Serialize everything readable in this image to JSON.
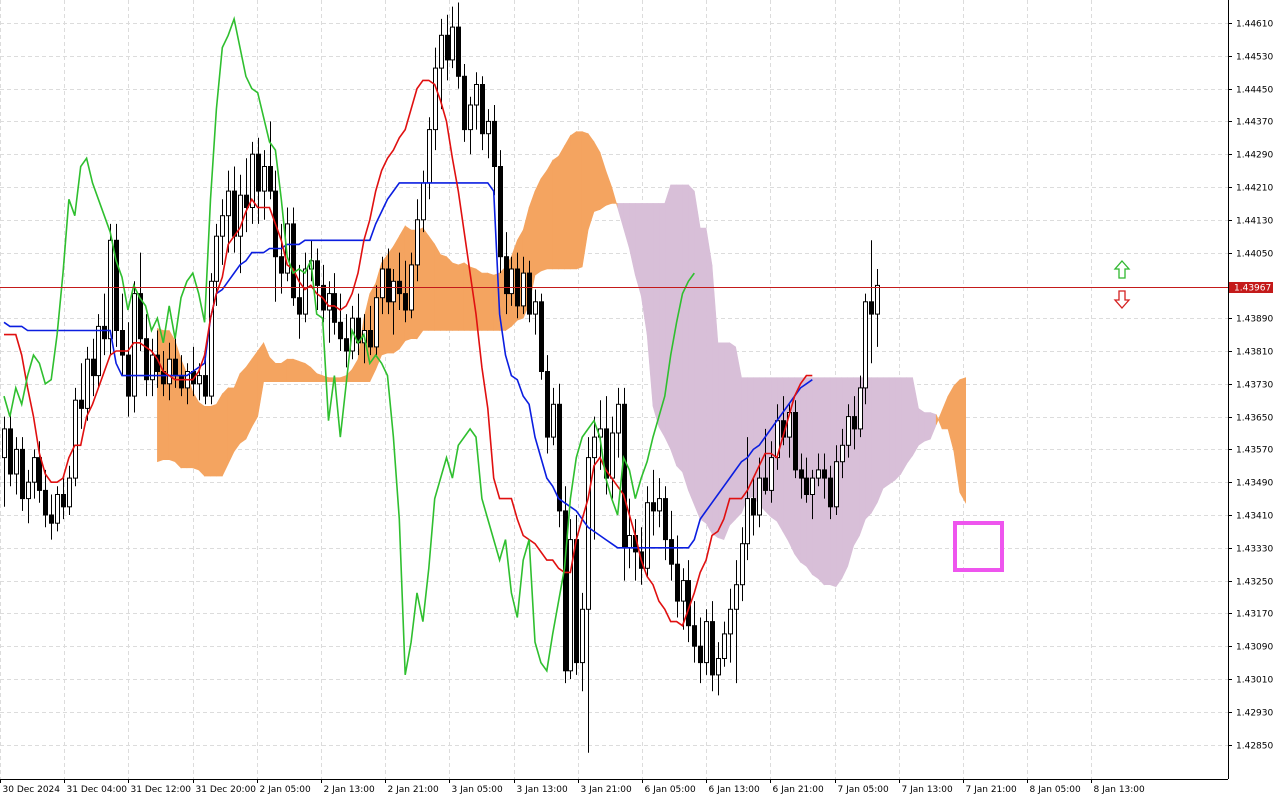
{
  "chart_data": {
    "type": "candlestick",
    "indicator": "Ichimoku",
    "grid": true,
    "ylim": [
      1.4277,
      1.4468
    ],
    "y_ticks": [
      "1.44610",
      "1.44530",
      "1.44450",
      "1.44370",
      "1.44290",
      "1.44210",
      "1.44130",
      "1.44050",
      "1.43890",
      "1.43810",
      "1.43730",
      "1.43650",
      "1.43570",
      "1.43490",
      "1.43410",
      "1.43330",
      "1.43250",
      "1.43170",
      "1.43090",
      "1.43010",
      "1.42930",
      "1.42850"
    ],
    "x_ticks": [
      "30 Dec 2024",
      "31 Dec 04:00",
      "31 Dec 12:00",
      "31 Dec 20:00",
      "2 Jan 05:00",
      "2 Jan 13:00",
      "2 Jan 21:00",
      "3 Jan 05:00",
      "3 Jan 13:00",
      "3 Jan 21:00",
      "6 Jan 05:00",
      "6 Jan 13:00",
      "6 Jan 21:00",
      "7 Jan 05:00",
      "7 Jan 13:00",
      "7 Jan 21:00",
      "8 Jan 05:00",
      "8 Jan 13:00"
    ],
    "current_price": "1.43967",
    "candles": [
      [
        1.4355,
        1.4365,
        1.4343,
        1.4362
      ],
      [
        1.4362,
        1.4366,
        1.4348,
        1.4351
      ],
      [
        1.4351,
        1.436,
        1.4346,
        1.4357
      ],
      [
        1.4357,
        1.436,
        1.4342,
        1.4345
      ],
      [
        1.4345,
        1.4352,
        1.4339,
        1.4349
      ],
      [
        1.4349,
        1.4357,
        1.4345,
        1.4355
      ],
      [
        1.4355,
        1.4359,
        1.4344,
        1.4347
      ],
      [
        1.4347,
        1.4352,
        1.4338,
        1.4341
      ],
      [
        1.4341,
        1.4346,
        1.4335,
        1.4339
      ],
      [
        1.4339,
        1.4348,
        1.4337,
        1.4346
      ],
      [
        1.4346,
        1.435,
        1.434,
        1.4343
      ],
      [
        1.4343,
        1.4353,
        1.4341,
        1.435
      ],
      [
        1.435,
        1.4372,
        1.4348,
        1.4369
      ],
      [
        1.4369,
        1.4378,
        1.4362,
        1.4367
      ],
      [
        1.4367,
        1.4382,
        1.4364,
        1.4379
      ],
      [
        1.4379,
        1.4384,
        1.437,
        1.4375
      ],
      [
        1.4375,
        1.439,
        1.4372,
        1.4387
      ],
      [
        1.4387,
        1.4395,
        1.438,
        1.4384
      ],
      [
        1.4384,
        1.4412,
        1.438,
        1.4408
      ],
      [
        1.4408,
        1.4412,
        1.4382,
        1.4386
      ],
      [
        1.4386,
        1.4395,
        1.4375,
        1.438
      ],
      [
        1.438,
        1.4388,
        1.4365,
        1.437
      ],
      [
        1.437,
        1.4398,
        1.4366,
        1.4395
      ],
      [
        1.4395,
        1.4405,
        1.4381,
        1.4384
      ],
      [
        1.4384,
        1.439,
        1.437,
        1.4374
      ],
      [
        1.4374,
        1.4384,
        1.437,
        1.438
      ],
      [
        1.438,
        1.4386,
        1.4372,
        1.4376
      ],
      [
        1.4376,
        1.4381,
        1.437,
        1.4373
      ],
      [
        1.4373,
        1.4383,
        1.4369,
        1.4379
      ],
      [
        1.4379,
        1.4385,
        1.4372,
        1.4375
      ],
      [
        1.4375,
        1.438,
        1.437,
        1.4372
      ],
      [
        1.4372,
        1.4378,
        1.4368,
        1.4376
      ],
      [
        1.4376,
        1.4382,
        1.437,
        1.4373
      ],
      [
        1.4373,
        1.4378,
        1.4369,
        1.4375
      ],
      [
        1.4375,
        1.438,
        1.4368,
        1.437
      ],
      [
        1.437,
        1.44,
        1.4368,
        1.4398
      ],
      [
        1.4398,
        1.4412,
        1.4392,
        1.4409
      ],
      [
        1.4409,
        1.4418,
        1.4402,
        1.4414
      ],
      [
        1.4414,
        1.4425,
        1.4405,
        1.442
      ],
      [
        1.442,
        1.4426,
        1.4405,
        1.4409
      ],
      [
        1.4409,
        1.4424,
        1.44,
        1.4419
      ],
      [
        1.4419,
        1.4428,
        1.441,
        1.4416
      ],
      [
        1.4416,
        1.4432,
        1.4412,
        1.4429
      ],
      [
        1.4429,
        1.4433,
        1.4412,
        1.442
      ],
      [
        1.442,
        1.443,
        1.4413,
        1.4426
      ],
      [
        1.4426,
        1.4437,
        1.4418,
        1.442
      ],
      [
        1.442,
        1.4425,
        1.4393,
        1.4404
      ],
      [
        1.4404,
        1.4412,
        1.4395,
        1.44
      ],
      [
        1.44,
        1.4416,
        1.4398,
        1.4412
      ],
      [
        1.4412,
        1.4416,
        1.4392,
        1.4394
      ],
      [
        1.4394,
        1.4402,
        1.4384,
        1.439
      ],
      [
        1.439,
        1.4405,
        1.4388,
        1.4401
      ],
      [
        1.4401,
        1.4408,
        1.4398,
        1.4403
      ],
      [
        1.4403,
        1.4406,
        1.4391,
        1.4397
      ],
      [
        1.4397,
        1.4402,
        1.4388,
        1.4391
      ],
      [
        1.4391,
        1.4398,
        1.4383,
        1.4395
      ],
      [
        1.4395,
        1.44,
        1.4385,
        1.4388
      ],
      [
        1.4388,
        1.4395,
        1.4381,
        1.4384
      ],
      [
        1.4384,
        1.439,
        1.4377,
        1.4381
      ],
      [
        1.4381,
        1.4392,
        1.4379,
        1.4389
      ],
      [
        1.4389,
        1.4395,
        1.438,
        1.4383
      ],
      [
        1.4383,
        1.439,
        1.4378,
        1.4386
      ],
      [
        1.4386,
        1.4392,
        1.438,
        1.4382
      ],
      [
        1.4382,
        1.4397,
        1.438,
        1.4394
      ],
      [
        1.4394,
        1.4404,
        1.439,
        1.4401
      ],
      [
        1.4401,
        1.4406,
        1.439,
        1.4393
      ],
      [
        1.4393,
        1.4401,
        1.4385,
        1.4398
      ],
      [
        1.4398,
        1.4405,
        1.4391,
        1.4395
      ],
      [
        1.4395,
        1.4403,
        1.4388,
        1.4391
      ],
      [
        1.4391,
        1.4405,
        1.4389,
        1.4402
      ],
      [
        1.4402,
        1.4418,
        1.4398,
        1.4413
      ],
      [
        1.4413,
        1.4425,
        1.441,
        1.4422
      ],
      [
        1.4422,
        1.4438,
        1.4418,
        1.4435
      ],
      [
        1.4435,
        1.4455,
        1.443,
        1.445
      ],
      [
        1.445,
        1.4462,
        1.444,
        1.4458
      ],
      [
        1.4458,
        1.4463,
        1.4447,
        1.4452
      ],
      [
        1.4452,
        1.4465,
        1.445,
        1.446
      ],
      [
        1.446,
        1.4466,
        1.4445,
        1.4448
      ],
      [
        1.4448,
        1.4451,
        1.4432,
        1.4435
      ],
      [
        1.4435,
        1.4443,
        1.4429,
        1.4441
      ],
      [
        1.4441,
        1.4449,
        1.4435,
        1.4446
      ],
      [
        1.4446,
        1.4448,
        1.443,
        1.4434
      ],
      [
        1.4434,
        1.444,
        1.4428,
        1.4437
      ],
      [
        1.4437,
        1.4441,
        1.4419,
        1.4426
      ],
      [
        1.4426,
        1.443,
        1.44,
        1.4404
      ],
      [
        1.4404,
        1.441,
        1.439,
        1.4395
      ],
      [
        1.4395,
        1.4404,
        1.4392,
        1.4401
      ],
      [
        1.4401,
        1.4405,
        1.4389,
        1.4392
      ],
      [
        1.4392,
        1.4404,
        1.439,
        1.44
      ],
      [
        1.44,
        1.4403,
        1.4388,
        1.439
      ],
      [
        1.439,
        1.4396,
        1.4385,
        1.4393
      ],
      [
        1.4393,
        1.4395,
        1.4374,
        1.4376
      ],
      [
        1.4376,
        1.438,
        1.4356,
        1.436
      ],
      [
        1.436,
        1.4372,
        1.4358,
        1.4368
      ],
      [
        1.4368,
        1.4373,
        1.4338,
        1.4342
      ],
      [
        1.4342,
        1.4348,
        1.43,
        1.4303
      ],
      [
        1.4303,
        1.434,
        1.4301,
        1.4335
      ],
      [
        1.4335,
        1.4341,
        1.4302,
        1.4305
      ],
      [
        1.4305,
        1.4322,
        1.4298,
        1.4318
      ],
      [
        1.4318,
        1.436,
        1.4283,
        1.4355
      ],
      [
        1.4355,
        1.4365,
        1.4335,
        1.436
      ],
      [
        1.436,
        1.4369,
        1.4352,
        1.4362
      ],
      [
        1.4362,
        1.437,
        1.4346,
        1.435
      ],
      [
        1.435,
        1.4365,
        1.4345,
        1.4361
      ],
      [
        1.4361,
        1.4372,
        1.4355,
        1.4368
      ],
      [
        1.4368,
        1.4372,
        1.4325,
        1.4333
      ],
      [
        1.4333,
        1.4345,
        1.4328,
        1.4336
      ],
      [
        1.4336,
        1.434,
        1.4325,
        1.4332
      ],
      [
        1.4332,
        1.4338,
        1.4324,
        1.4328
      ],
      [
        1.4328,
        1.4348,
        1.4326,
        1.4344
      ],
      [
        1.4344,
        1.4352,
        1.4336,
        1.4342
      ],
      [
        1.4342,
        1.435,
        1.4338,
        1.4345
      ],
      [
        1.4345,
        1.4348,
        1.433,
        1.4335
      ],
      [
        1.4335,
        1.4342,
        1.4325,
        1.4329
      ],
      [
        1.4329,
        1.4336,
        1.4316,
        1.432
      ],
      [
        1.432,
        1.4328,
        1.4313,
        1.4325
      ],
      [
        1.4325,
        1.433,
        1.431,
        1.4314
      ],
      [
        1.4314,
        1.432,
        1.4305,
        1.4309
      ],
      [
        1.4309,
        1.4316,
        1.43,
        1.4305
      ],
      [
        1.4305,
        1.4318,
        1.4302,
        1.4315
      ],
      [
        1.4315,
        1.432,
        1.4298,
        1.4302
      ],
      [
        1.4302,
        1.431,
        1.4297,
        1.4306
      ],
      [
        1.4306,
        1.4315,
        1.4304,
        1.4312
      ],
      [
        1.4312,
        1.4323,
        1.4305,
        1.4318
      ],
      [
        1.4318,
        1.433,
        1.43,
        1.4324
      ],
      [
        1.4324,
        1.4338,
        1.432,
        1.4334
      ],
      [
        1.4334,
        1.436,
        1.433,
        1.4345
      ],
      [
        1.4345,
        1.435,
        1.4336,
        1.4341
      ],
      [
        1.4341,
        1.4355,
        1.4338,
        1.435
      ],
      [
        1.435,
        1.4362,
        1.4346,
        1.4347
      ],
      [
        1.4347,
        1.4359,
        1.4344,
        1.4355
      ],
      [
        1.4355,
        1.4368,
        1.4352,
        1.4364
      ],
      [
        1.4364,
        1.437,
        1.4358,
        1.436
      ],
      [
        1.436,
        1.4368,
        1.4355,
        1.4366
      ],
      [
        1.4366,
        1.4369,
        1.435,
        1.4352
      ],
      [
        1.4352,
        1.4356,
        1.4345,
        1.435
      ],
      [
        1.435,
        1.4355,
        1.4344,
        1.4346
      ],
      [
        1.4346,
        1.4352,
        1.434,
        1.435
      ],
      [
        1.435,
        1.4356,
        1.4348,
        1.4352
      ],
      [
        1.4352,
        1.4356,
        1.4345,
        1.435
      ],
      [
        1.435,
        1.4353,
        1.434,
        1.4343
      ],
      [
        1.4343,
        1.4358,
        1.4341,
        1.4354
      ],
      [
        1.4354,
        1.4362,
        1.435,
        1.4358
      ],
      [
        1.4358,
        1.4368,
        1.4355,
        1.4365
      ],
      [
        1.4365,
        1.437,
        1.4357,
        1.4362
      ],
      [
        1.4362,
        1.4375,
        1.436,
        1.4372
      ],
      [
        1.4372,
        1.4395,
        1.4368,
        1.4393
      ],
      [
        1.4393,
        1.4408,
        1.4378,
        1.439
      ],
      [
        1.439,
        1.4401,
        1.4382,
        1.4397
      ]
    ],
    "tenkan": [
      1.4385,
      1.4385,
      1.4385,
      1.438,
      1.4372,
      1.4365,
      1.4356,
      1.4351,
      1.4349,
      1.4349,
      1.435,
      1.4355,
      1.4358,
      1.4358,
      1.4365,
      1.4368,
      1.4372,
      1.4376,
      1.438,
      1.4381,
      1.4381,
      1.4381,
      1.4383,
      1.4383,
      1.4382,
      1.4381,
      1.4379,
      1.4376,
      1.4375,
      1.4374,
      1.4374,
      1.4374,
      1.4374,
      1.4376,
      1.438,
      1.4389,
      1.4395,
      1.4399,
      1.4407,
      1.4409,
      1.4411,
      1.4415,
      1.4418,
      1.4416,
      1.4416,
      1.4416,
      1.4412,
      1.4408,
      1.4402,
      1.4401,
      1.4398,
      1.4396,
      1.4397,
      1.4395,
      1.4394,
      1.4392,
      1.4392,
      1.4391,
      1.4392,
      1.4395,
      1.44,
      1.4408,
      1.4413,
      1.442,
      1.4425,
      1.4428,
      1.443,
      1.4433,
      1.4435,
      1.444,
      1.4445,
      1.4447,
      1.4447,
      1.4446,
      1.4442,
      1.4437,
      1.4428,
      1.442,
      1.441,
      1.44,
      1.439,
      1.4377,
      1.4367,
      1.435,
      1.4345,
      1.4345,
      1.4345,
      1.434,
      1.4336,
      1.4335,
      1.4334,
      1.4332,
      1.433,
      1.433,
      1.4328,
      1.4327,
      1.4327,
      1.4335,
      1.434,
      1.4345,
      1.4353,
      1.4355,
      1.4352,
      1.435,
      1.4348,
      1.4346,
      1.4341,
      1.4336,
      1.433,
      1.4326,
      1.4324,
      1.432,
      1.4318,
      1.4315,
      1.4315,
      1.4314,
      1.4318,
      1.4322,
      1.4327,
      1.433,
      1.4336,
      1.4337,
      1.434,
      1.4345,
      1.4345,
      1.4345,
      1.4347,
      1.435,
      1.4353,
      1.4356,
      1.4356,
      1.4355,
      1.436,
      1.4365,
      1.437,
      1.4373,
      1.4375,
      1.4375
    ],
    "kijun": [
      1.4388,
      1.4387,
      1.4387,
      1.4387,
      1.4386,
      1.4386,
      1.4386,
      1.4386,
      1.4386,
      1.4386,
      1.4386,
      1.4386,
      1.4386,
      1.4386,
      1.4386,
      1.4386,
      1.4386,
      1.4386,
      1.4386,
      1.4378,
      1.4375,
      1.4375,
      1.4375,
      1.4375,
      1.4375,
      1.4375,
      1.4375,
      1.4375,
      1.4375,
      1.4375,
      1.4375,
      1.4375,
      1.4376,
      1.4377,
      1.4378,
      1.4389,
      1.4395,
      1.4396,
      1.4398,
      1.44,
      1.4402,
      1.4403,
      1.4405,
      1.4405,
      1.4405,
      1.4406,
      1.4406,
      1.4406,
      1.4407,
      1.4407,
      1.4407,
      1.4408,
      1.4408,
      1.4408,
      1.4408,
      1.4408,
      1.4408,
      1.4408,
      1.4408,
      1.4408,
      1.4408,
      1.4408,
      1.4408,
      1.4412,
      1.4415,
      1.4418,
      1.442,
      1.4422,
      1.4422,
      1.4422,
      1.4422,
      1.4422,
      1.4422,
      1.4422,
      1.4422,
      1.4422,
      1.4422,
      1.4422,
      1.4422,
      1.4422,
      1.4422,
      1.4422,
      1.4422,
      1.442,
      1.439,
      1.438,
      1.4375,
      1.4374,
      1.437,
      1.4368,
      1.436,
      1.4355,
      1.435,
      1.4348,
      1.4345,
      1.4344,
      1.4343,
      1.4342,
      1.434,
      1.4338,
      1.4337,
      1.4336,
      1.4335,
      1.4334,
      1.4333,
      1.4333,
      1.4333,
      1.4333,
      1.4333,
      1.4333,
      1.4333,
      1.4333,
      1.4333,
      1.4333,
      1.4333,
      1.4333,
      1.4333,
      1.4335,
      1.434,
      1.4342,
      1.4344,
      1.4346,
      1.4348,
      1.435,
      1.4352,
      1.4354,
      1.4355,
      1.4357,
      1.4358,
      1.436,
      1.4362,
      1.4364,
      1.4366,
      1.4368,
      1.437,
      1.4372,
      1.4373,
      1.4374
    ],
    "chikou": [
      1.437,
      1.4365,
      1.4372,
      1.4368,
      1.4375,
      1.438,
      1.4378,
      1.4373,
      1.4374,
      1.4385,
      1.44,
      1.4418,
      1.4414,
      1.4426,
      1.4428,
      1.4422,
      1.4418,
      1.4414,
      1.441,
      1.4403,
      1.4399,
      1.4391,
      1.4397,
      1.4394,
      1.4392,
      1.4386,
      1.4389,
      1.4383,
      1.4392,
      1.4384,
      1.4394,
      1.4398,
      1.44,
      1.4395,
      1.4388,
      1.4418,
      1.444,
      1.4455,
      1.4458,
      1.4462,
      1.4455,
      1.4448,
      1.4445,
      1.4444,
      1.4438,
      1.4432,
      1.443,
      1.4418,
      1.4404,
      1.44,
      1.4401,
      1.44,
      1.4403,
      1.439,
      1.4389,
      1.4364,
      1.4375,
      1.436,
      1.4373,
      1.4386,
      1.4383,
      1.4385,
      1.4378,
      1.438,
      1.4378,
      1.4375,
      1.436,
      1.434,
      1.4302,
      1.431,
      1.4322,
      1.4315,
      1.4328,
      1.4345,
      1.435,
      1.4355,
      1.435,
      1.4358,
      1.436,
      1.4362,
      1.436,
      1.4345,
      1.434,
      1.4335,
      1.433,
      1.4335,
      1.4322,
      1.4316,
      1.433,
      1.4335,
      1.431,
      1.4305,
      1.4303,
      1.4312,
      1.432,
      1.4328,
      1.4345,
      1.4355,
      1.436,
      1.4362,
      1.4364,
      1.436,
      1.435,
      1.4345,
      1.4341,
      1.4355,
      1.4352,
      1.4345,
      1.435,
      1.4354,
      1.436,
      1.4365,
      1.437,
      1.438,
      1.4388,
      1.4395,
      1.4398,
      1.44
    ]
  }
}
